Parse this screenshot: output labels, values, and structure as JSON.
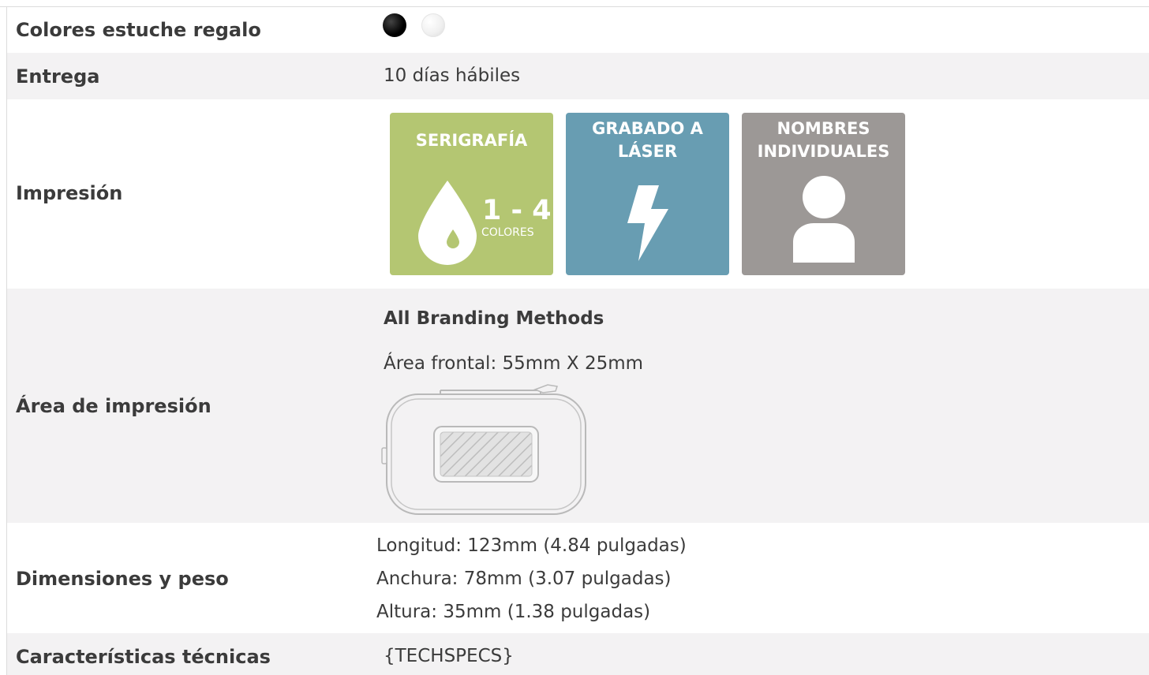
{
  "rows": {
    "gift_box_colors": {
      "label": "Colores estuche regalo",
      "swatches": [
        {
          "name": "black",
          "color": "#000000"
        },
        {
          "name": "white",
          "color": "#f4f4f4"
        }
      ]
    },
    "delivery": {
      "label": "Entrega",
      "value": "10 días hábiles"
    },
    "printing": {
      "label": "Impresión",
      "methods": [
        {
          "title": "SERIGRAFÍA",
          "icon": "ink-drop-icon",
          "count": "1 - 4",
          "count_label": "COLORES",
          "color": "#b4c672"
        },
        {
          "title": "GRABADO A\nLÁSER",
          "icon": "lightning-bolt-icon",
          "color": "#689db2"
        },
        {
          "title": "NOMBRES\nINDIVIDUALES",
          "icon": "person-icon",
          "color": "#9c9896"
        }
      ]
    },
    "print_area": {
      "label": "Área de impresión",
      "heading": "All Branding Methods",
      "front_area": "Área frontal: 55mm X 25mm"
    },
    "dimensions": {
      "label": "Dimensiones y peso",
      "lines": [
        "Longitud: 123mm (4.84 pulgadas)",
        "Anchura: 78mm (3.07 pulgadas)",
        "Altura: 35mm (1.38 pulgadas)"
      ]
    },
    "tech_specs": {
      "label": "Características técnicas",
      "value": "{TECHSPECS}"
    }
  }
}
